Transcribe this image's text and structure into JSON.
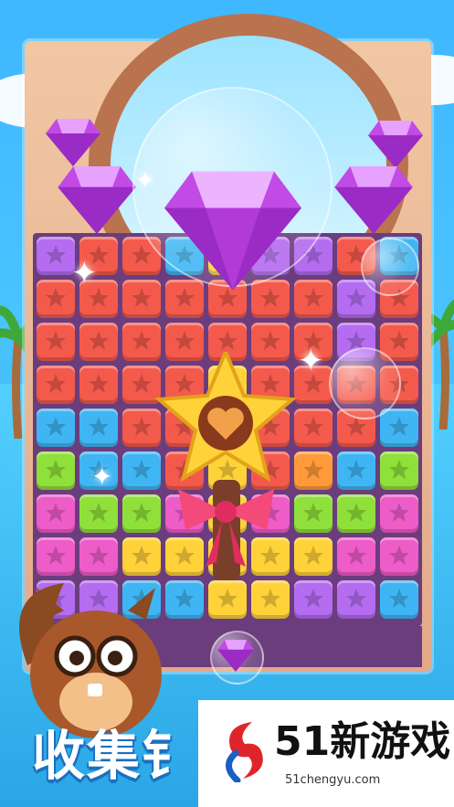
{
  "promo": {
    "caption_visible": "收集钅",
    "full_caption": "收集钻石"
  },
  "watermark": {
    "brand_number": "51",
    "brand_text": "新游戏",
    "url": "51chengyu.com"
  },
  "board": {
    "rows": [
      [
        "purple",
        "red",
        "red",
        "blue",
        "yellow",
        "purple",
        "purple",
        "red",
        "blue"
      ],
      [
        "red",
        "red",
        "red",
        "red",
        "red",
        "red",
        "red",
        "purple",
        "red"
      ],
      [
        "red",
        "red",
        "red",
        "red",
        "red",
        "red",
        "red",
        "purple",
        "red"
      ],
      [
        "red",
        "red",
        "red",
        "red",
        "yellow",
        "red",
        "red",
        "red",
        "red"
      ],
      [
        "blue",
        "blue",
        "red",
        "red",
        "yellow",
        "red",
        "red",
        "red",
        "blue"
      ],
      [
        "green",
        "blue",
        "blue",
        "red",
        "yellow",
        "red",
        "orange",
        "blue",
        "green"
      ],
      [
        "pink",
        "green",
        "green",
        "pink",
        "yellow",
        "pink",
        "green",
        "green",
        "pink"
      ],
      [
        "pink",
        "pink",
        "yellow",
        "yellow",
        "yellow",
        "yellow",
        "yellow",
        "pink",
        "pink"
      ],
      [
        "purple",
        "purple",
        "blue",
        "blue",
        "yellow",
        "yellow",
        "purple",
        "purple",
        "blue"
      ]
    ],
    "tile_colors": {
      "purple": "#b46cf0",
      "red": "#f45a4c",
      "blue": "#3fb6f3",
      "yellow": "#ffd23a",
      "pink": "#ee5cc8",
      "green": "#8fe03a",
      "orange": "#ff9a3a"
    }
  },
  "colors": {
    "gem": "#c24be6",
    "frame": "#e7b08f",
    "grid_bg": "#6b3d7d",
    "caption_outline": "#1b6fc0"
  }
}
